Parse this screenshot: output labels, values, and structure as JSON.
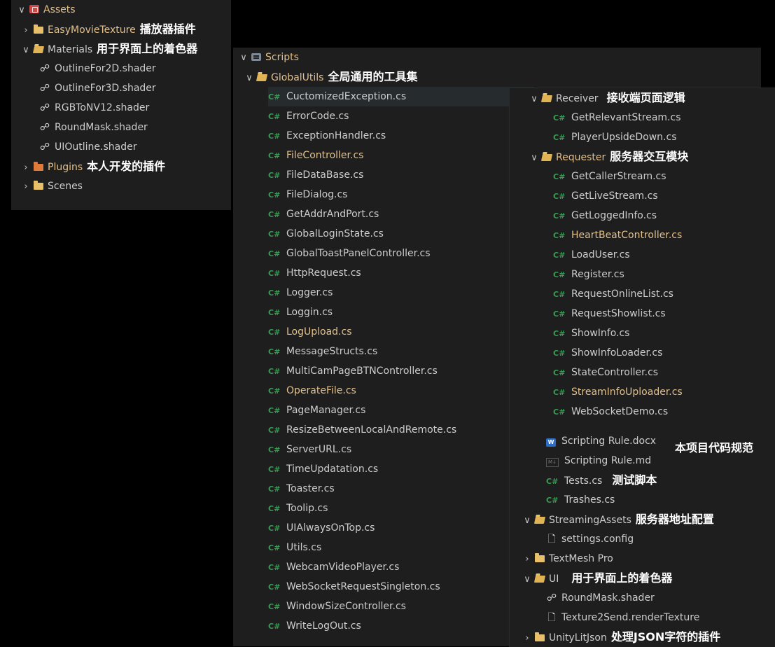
{
  "colors": {
    "modified": "#e2c08d",
    "text": "#cccccc",
    "note": "#ffffff",
    "cs_icon": "#3a9a55"
  },
  "assets": {
    "root": "Assets",
    "easy_movie": "EasyMovieTexture",
    "easy_movie_note": "播放器插件",
    "materials": "Materials",
    "materials_note": "用于界面上的着色器",
    "shaders": [
      "OutlineFor2D.shader",
      "OutlineFor3D.shader",
      "RGBToNV12.shader",
      "RoundMask.shader",
      "UIOutline.shader"
    ],
    "plugins": "Plugins",
    "plugins_note": "本人开发的插件",
    "scenes": "Scenes"
  },
  "scripts": {
    "root": "Scripts",
    "global_utils": "GlobalUtils",
    "global_utils_note": "全局通用的工具集",
    "files": [
      "CuctomizedException.cs",
      "ErrorCode.cs",
      "ExceptionHandler.cs",
      "FileController.cs",
      "FileDataBase.cs",
      "FileDialog.cs",
      "GetAddrAndPort.cs",
      "GlobalLoginState.cs",
      "GlobalToastPanelController.cs",
      "HttpRequest.cs",
      "Logger.cs",
      "Loggin.cs",
      "LogUpload.cs",
      "MessageStructs.cs",
      "MultiCamPageBTNController.cs",
      "OperateFile.cs",
      "PageManager.cs",
      "ResizeBetweenLocalAndRemote.cs",
      "ServerURL.cs",
      "TimeUpdatation.cs",
      "Toaster.cs",
      "Toolip.cs",
      "UIAlwaysOnTop.cs",
      "Utils.cs",
      "WebcamVideoPlayer.cs",
      "WebSocketRequestSingleton.cs",
      "WindowSizeController.cs",
      "WriteLogOut.cs"
    ]
  },
  "receiver": {
    "folder": "Receiver",
    "note": "接收端页面逻辑",
    "files": [
      "GetRelevantStream.cs",
      "PlayerUpsideDown.cs"
    ]
  },
  "requester": {
    "folder": "Requester",
    "note": "服务器交互模块",
    "files": [
      "GetCallerStream.cs",
      "GetLiveStream.cs",
      "GetLoggedInfo.cs",
      "HeartBeatController.cs",
      "LoadUser.cs",
      "Register.cs",
      "RequestOnlineList.cs",
      "RequestShowlist.cs",
      "ShowInfo.cs",
      "ShowInfoLoader.cs",
      "StateController.cs",
      "StreamInfoUploader.cs",
      "WebSocketDemo.cs"
    ]
  },
  "misc": {
    "rule_docx": "Scripting Rule.docx",
    "rule_md": "Scripting Rule.md",
    "rule_note": "本项目代码规范",
    "tests": "Tests.cs",
    "tests_note": "测试脚本",
    "trashes": "Trashes.cs",
    "streaming": "StreamingAssets",
    "streaming_note": "服务器地址配置",
    "settings": "settings.config",
    "textmesh": "TextMesh Pro",
    "ui": "UI",
    "ui_note": "用于界面上的着色器",
    "ui_shader": "RoundMask.shader",
    "ui_texture": "Texture2Send.renderTexture",
    "litjson": "UnityLitJson",
    "litjson_note": "处理JSON字符的插件"
  },
  "icons": {
    "chevron_down": "∨",
    "chevron_right": "›",
    "cs": "C#",
    "shader": "☍",
    "file": "🗋",
    "word": "W",
    "md": "M↓"
  }
}
